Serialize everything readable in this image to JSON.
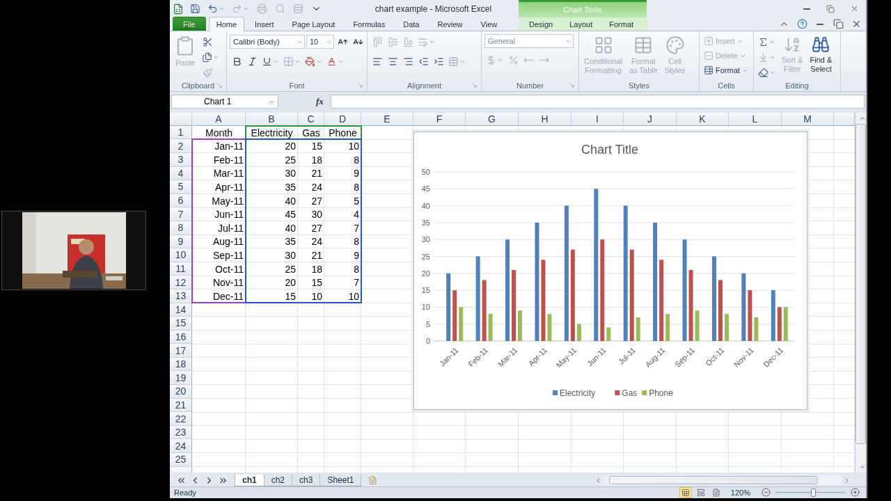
{
  "window": {
    "title": "chart example  -  Microsoft Excel",
    "context_title": "Chart Tools"
  },
  "tabs": [
    {
      "label": "File",
      "kind": "file",
      "selected": false
    },
    {
      "label": "Home",
      "kind": "standard",
      "selected": true
    },
    {
      "label": "Insert",
      "kind": "standard",
      "selected": false
    },
    {
      "label": "Page Layout",
      "kind": "standard",
      "selected": false
    },
    {
      "label": "Formulas",
      "kind": "standard",
      "selected": false
    },
    {
      "label": "Data",
      "kind": "standard",
      "selected": false
    },
    {
      "label": "Review",
      "kind": "standard",
      "selected": false
    },
    {
      "label": "View",
      "kind": "standard",
      "selected": false
    },
    {
      "label": "Design",
      "kind": "contextual",
      "selected": false
    },
    {
      "label": "Layout",
      "kind": "contextual",
      "selected": false
    },
    {
      "label": "Format",
      "kind": "contextual",
      "selected": false
    }
  ],
  "ribbon": {
    "clipboard": {
      "label": "Clipboard",
      "paste": {
        "label": "Paste",
        "disabled": true
      }
    },
    "font": {
      "label": "Font",
      "font_name": "Calibri (Body)",
      "font_size": "10"
    },
    "alignment": {
      "label": "Alignment"
    },
    "number": {
      "label": "Number",
      "format": "General"
    },
    "styles": {
      "label": "Styles",
      "buttons": [
        {
          "lines": [
            "Conditional",
            "Formatting"
          ],
          "disabled": true
        },
        {
          "lines": [
            "Format",
            "as Table"
          ],
          "disabled": true
        },
        {
          "lines": [
            "Cell",
            "Styles"
          ],
          "disabled": true
        }
      ]
    },
    "cells": {
      "label": "Cells",
      "buttons": [
        {
          "label": "Insert",
          "disabled": true
        },
        {
          "label": "Delete",
          "disabled": true
        },
        {
          "label": "Format",
          "disabled": false
        }
      ]
    },
    "editing": {
      "label": "Editing",
      "buttons": [
        {
          "lines": [
            "Sort &",
            "Filter"
          ],
          "disabled": true
        },
        {
          "lines": [
            "Find &",
            "Select"
          ],
          "disabled": false
        }
      ]
    }
  },
  "formula_bar": {
    "name_box": "Chart 1",
    "function_label": "fx"
  },
  "sheet": {
    "columns": [
      "A",
      "B",
      "C",
      "D",
      "E",
      "F",
      "G",
      "H",
      "I",
      "J",
      "K",
      "L",
      "M"
    ],
    "rows": [
      {
        "number": "1",
        "cells": [
          "Month",
          "Electricity",
          "Gas",
          "Phone"
        ]
      },
      {
        "number": "2",
        "cells": [
          "Jan-11",
          "20",
          "15",
          "10"
        ]
      },
      {
        "number": "3",
        "cells": [
          "Feb-11",
          "25",
          "18",
          "8"
        ]
      },
      {
        "number": "4",
        "cells": [
          "Mar-11",
          "30",
          "21",
          "9"
        ]
      },
      {
        "number": "5",
        "cells": [
          "Apr-11",
          "35",
          "24",
          "8"
        ]
      },
      {
        "number": "6",
        "cells": [
          "May-11",
          "40",
          "27",
          "5"
        ]
      },
      {
        "number": "7",
        "cells": [
          "Jun-11",
          "45",
          "30",
          "4"
        ]
      },
      {
        "number": "8",
        "cells": [
          "Jul-11",
          "40",
          "27",
          "7"
        ]
      },
      {
        "number": "9",
        "cells": [
          "Aug-11",
          "35",
          "24",
          "8"
        ]
      },
      {
        "number": "10",
        "cells": [
          "Sep-11",
          "30",
          "21",
          "9"
        ]
      },
      {
        "number": "11",
        "cells": [
          "Oct-11",
          "25",
          "18",
          "8"
        ]
      },
      {
        "number": "12",
        "cells": [
          "Nov-11",
          "20",
          "15",
          "7"
        ]
      },
      {
        "number": "13",
        "cells": [
          "Dec-11",
          "15",
          "10",
          "10"
        ]
      },
      {
        "number": "14"
      },
      {
        "number": "15"
      },
      {
        "number": "16"
      },
      {
        "number": "17"
      },
      {
        "number": "18"
      },
      {
        "number": "19"
      },
      {
        "number": "20"
      },
      {
        "number": "21"
      },
      {
        "number": "22"
      },
      {
        "number": "23"
      },
      {
        "number": "24"
      },
      {
        "number": "25"
      }
    ],
    "chart": {
      "chart_data": {
        "type": "bar",
        "title": "Chart Title",
        "categories": [
          "Jan-11",
          "Feb-11",
          "Mar-11",
          "Apr-11",
          "May-11",
          "Jun-11",
          "Jul-11",
          "Aug-11",
          "Sep-11",
          "Oct-11",
          "Nov-11",
          "Dec-11"
        ],
        "series": [
          {
            "name": "Electricity",
            "color": "#4f81bd",
            "values": [
              20,
              25,
              30,
              35,
              40,
              45,
              40,
              35,
              30,
              25,
              20,
              15
            ]
          },
          {
            "name": "Gas",
            "color": "#c0504d",
            "values": [
              15,
              18,
              21,
              24,
              27,
              30,
              27,
              24,
              21,
              18,
              15,
              10
            ]
          },
          {
            "name": "Phone",
            "color": "#9bbb59",
            "values": [
              10,
              8,
              9,
              8,
              5,
              4,
              7,
              8,
              9,
              8,
              7,
              10
            ]
          }
        ],
        "legend": true,
        "grid": true,
        "ylim": [
          0,
          50
        ],
        "yticks": [
          0,
          5,
          10,
          15,
          20,
          25,
          30,
          35,
          40,
          45,
          50
        ]
      }
    }
  },
  "sheet_tabs": [
    {
      "label": "ch1",
      "selected": true
    },
    {
      "label": "ch2",
      "selected": false
    },
    {
      "label": "ch3",
      "selected": false
    },
    {
      "label": "Sheet1",
      "selected": false
    }
  ],
  "status_bar": {
    "status": "Ready",
    "zoom": "120%",
    "zoom_slider": {
      "level": 0.54
    }
  }
}
